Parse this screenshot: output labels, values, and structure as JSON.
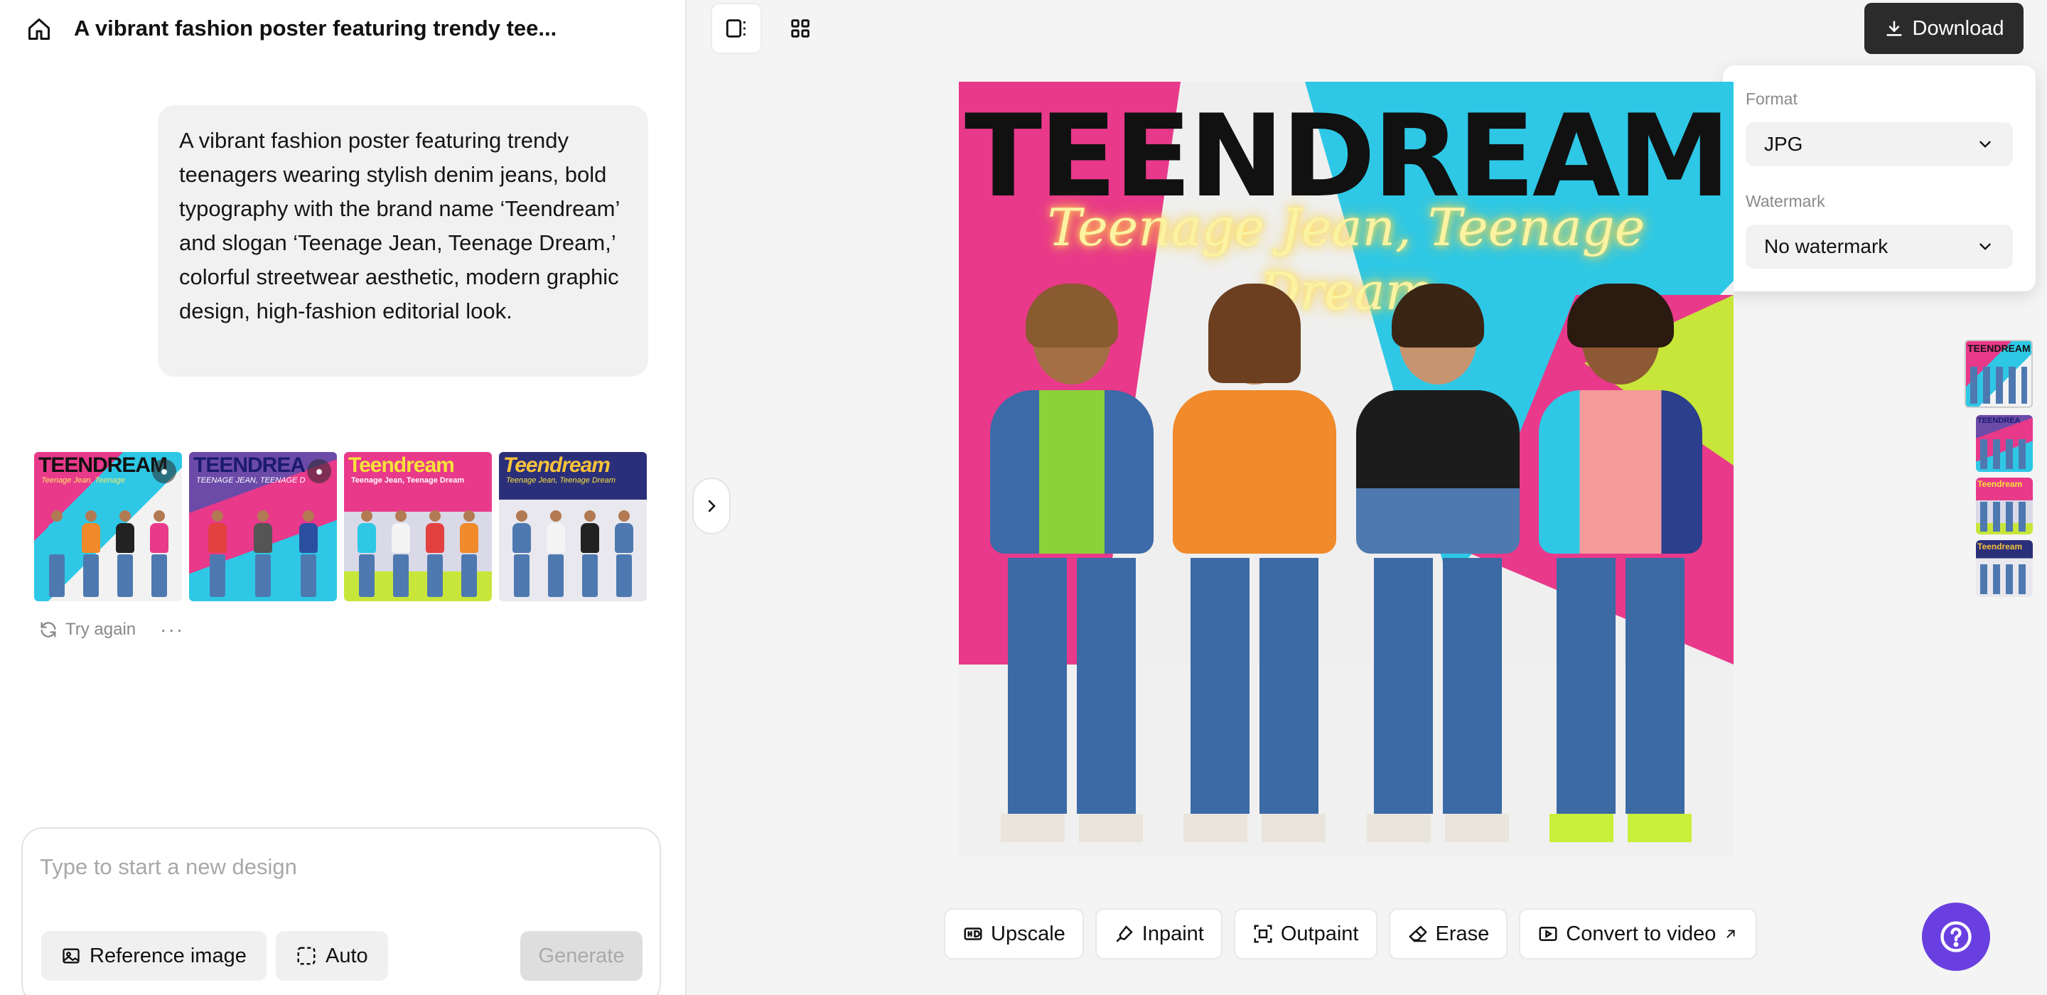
{
  "header": {
    "title": "A vibrant fashion poster featuring trendy tee..."
  },
  "prompt": {
    "text": "A vibrant fashion poster featuring trendy teenagers wearing stylish denim jeans, bold typography with the brand name ‘Teendream’ and slogan ‘Teenage Jean, Teenage Dream,’ colorful streetwear aesthetic, modern graphic design, high-fashion editorial look."
  },
  "results": {
    "thumbnails": [
      {
        "word": "TEENDREAM",
        "sub": "Teenage Jean, Teenage"
      },
      {
        "word": "TEENDREA",
        "sub": "TEENAGE JEAN, TEENAGE D"
      },
      {
        "word": "Teendream",
        "sub": "Teenage Jean,   Teenage Dream"
      },
      {
        "word": "Teendream",
        "sub": "Teenage Jean, Teenage Dream"
      }
    ],
    "try_again_label": "Try again",
    "more_label": "···"
  },
  "composer": {
    "placeholder": "Type to start a new design",
    "reference_label": "Reference image",
    "auto_label": "Auto",
    "generate_label": "Generate"
  },
  "download": {
    "label": "Download",
    "format_label": "Format",
    "format_value": "JPG",
    "watermark_label": "Watermark",
    "watermark_value": "No watermark"
  },
  "poster": {
    "title": "TEENDREAM",
    "slogan": "Teenage Jean, Teenage Dream"
  },
  "side_thumbnails": [
    {
      "word": "TEENDREAM"
    },
    {
      "word": "TEENDREA"
    },
    {
      "word": "Teendream"
    },
    {
      "word": "Teendream"
    }
  ],
  "toolbar": {
    "upscale": "Upscale",
    "inpaint": "Inpaint",
    "outpaint": "Outpaint",
    "erase": "Erase",
    "convert": "Convert to video"
  },
  "colors": {
    "accent": "#6a3fe0",
    "download_bg": "#2b2b2b",
    "poster_pink": "#e8398a",
    "poster_cyan": "#2ec8e6",
    "poster_lime": "#c8e63a"
  }
}
